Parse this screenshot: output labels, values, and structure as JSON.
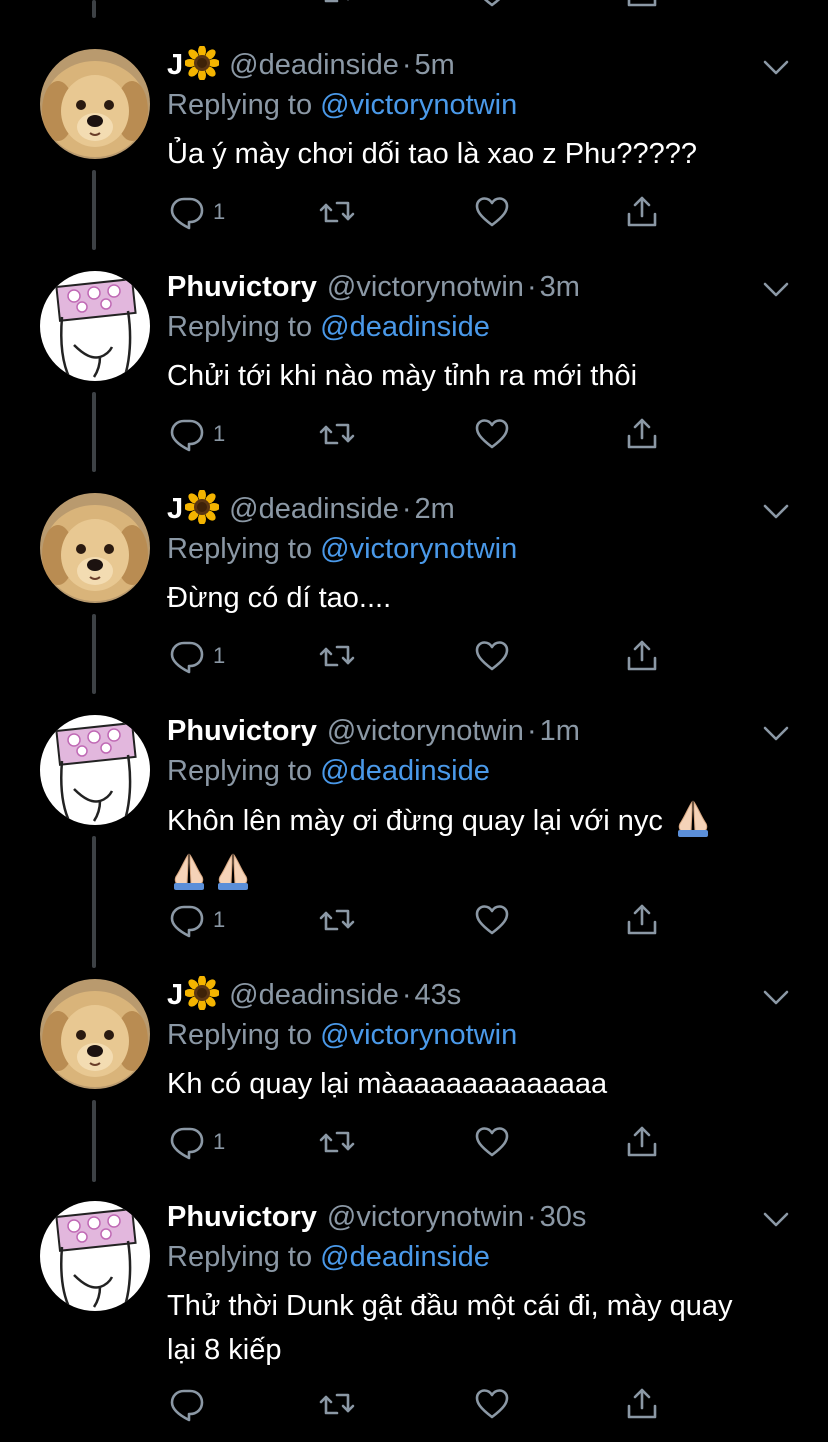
{
  "colors": {
    "background": "#000000",
    "name": "#ffffff",
    "secondary": "#8b98a5",
    "mention": "#4a99e9",
    "thread_line": "#3d4145"
  },
  "tweets": [
    {
      "avatar": "puppy",
      "name": "J",
      "name_emoji": "sunflower-emoji",
      "handle": "@deadinside",
      "separator": "·",
      "time": "5m",
      "replying_label": "Replying to",
      "replying_to": "@victorynotwin",
      "text": "Ủa ý mày chơi dối tao là xao z Phu?????",
      "reply_count": "1"
    },
    {
      "avatar": "drawing",
      "name": "Phuvictory",
      "handle": "@victorynotwin",
      "separator": "·",
      "time": "3m",
      "replying_label": "Replying to",
      "replying_to": "@deadinside",
      "text": "Chửi tới khi nào mày tỉnh ra mới thôi",
      "reply_count": "1"
    },
    {
      "avatar": "puppy",
      "name": "J",
      "name_emoji": "sunflower-emoji",
      "handle": "@deadinside",
      "separator": "·",
      "time": "2m",
      "replying_label": "Replying to",
      "replying_to": "@victorynotwin",
      "text": "Đừng có dí tao....",
      "reply_count": "1"
    },
    {
      "avatar": "drawing",
      "name": "Phuvictory",
      "handle": "@victorynotwin",
      "separator": "·",
      "time": "1m",
      "replying_label": "Replying to",
      "replying_to": "@deadinside",
      "text": "Khôn lên mày ơi đừng quay lại với nyc",
      "text_emoji": "folded-hands-emoji ×3",
      "reply_count": "1"
    },
    {
      "avatar": "puppy",
      "name": "J",
      "name_emoji": "sunflower-emoji",
      "handle": "@deadinside",
      "separator": "·",
      "time": "43s",
      "replying_label": "Replying to",
      "replying_to": "@victorynotwin",
      "text": "Kh có quay lại màaaaaaaaaaaaaa",
      "reply_count": "1"
    },
    {
      "avatar": "drawing",
      "name": "Phuvictory",
      "handle": "@victorynotwin",
      "separator": "·",
      "time": "30s",
      "replying_label": "Replying to",
      "replying_to": "@deadinside",
      "text": "Thử thời Dunk gật đầu một cái đi, mày quay lại 8 kiếp",
      "reply_count": ""
    }
  ],
  "icons": {
    "reply": "reply-icon",
    "retweet": "retweet-icon",
    "like": "heart-icon",
    "share": "share-icon",
    "more": "chevron-down-icon"
  }
}
